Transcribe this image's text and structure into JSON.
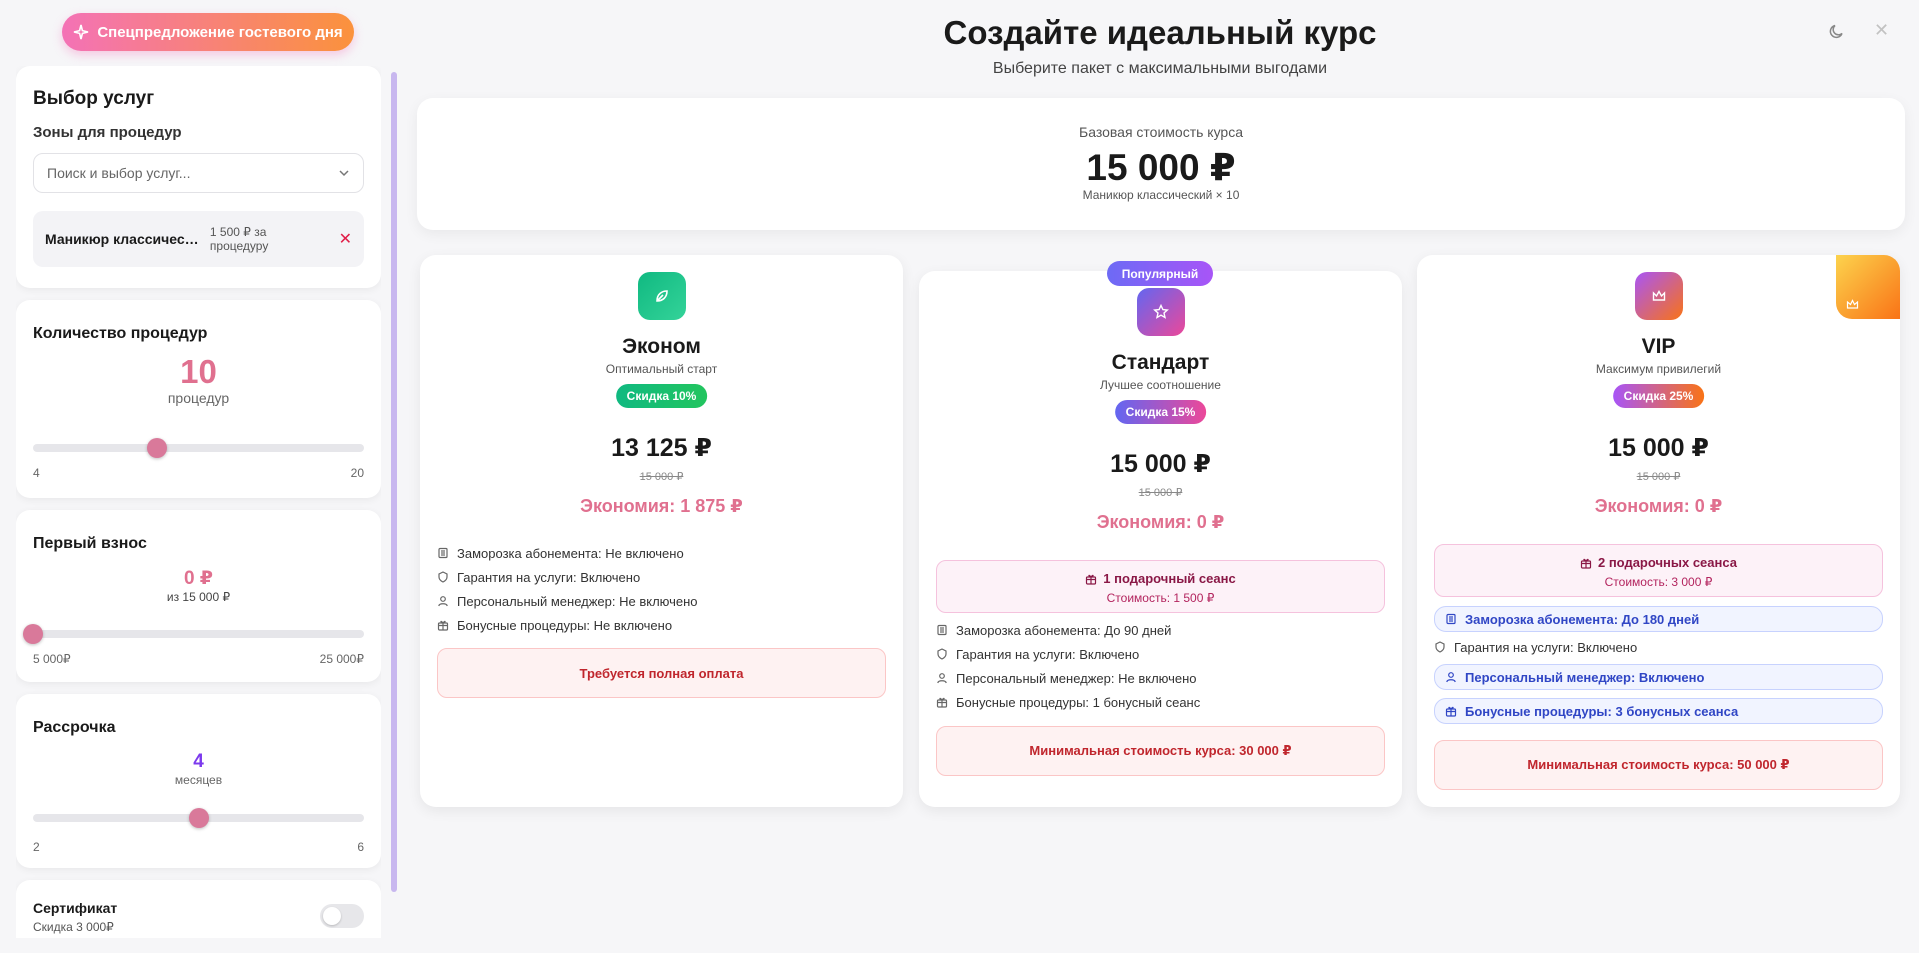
{
  "promo": {
    "label": "Спецпредложение гостевого дня",
    "icon": "sparkles-icon"
  },
  "header": {
    "title": "Создайте идеальный курс",
    "subtitle": "Выберите пакет с максимальными выгодами"
  },
  "top_icons": {
    "theme": "moon-icon",
    "close": "close-icon",
    "close_glyph": "✕"
  },
  "sidebar": {
    "services": {
      "title": "Выбор услуг",
      "zones_label": "Зоны для процедур",
      "search_placeholder": "Поиск и выбор услуг...",
      "selected": {
        "name": "Маникюр классический",
        "price": "1 500 ₽ за процедуру",
        "remove": "✕"
      }
    },
    "count": {
      "title": "Количество процедур",
      "value": "10",
      "unit": "процедур",
      "min": "4",
      "max": "20",
      "level": 0.375
    },
    "deposit": {
      "title": "Первый взнос",
      "value": "0 ₽",
      "of": "из 15 000 ₽",
      "min": "5 000₽",
      "max": "25 000₽",
      "level": 0
    },
    "installment": {
      "title": "Рассрочка",
      "value": "4",
      "unit": "месяцев",
      "min": "2",
      "max": "6",
      "level": 0.5
    },
    "certificate": {
      "title": "Сертификат",
      "sub": "Скидка 3 000₽",
      "enabled": false
    }
  },
  "base": {
    "label": "Базовая стоимость курса",
    "value": "15 000 ₽",
    "sub": "Маникюр классический × 10"
  },
  "popular_label": "Популярный",
  "plans": [
    {
      "name": "Эконом",
      "tagline": "Оптимальный старт",
      "discount": "Скидка 10%",
      "icon": "leaf-icon",
      "price": "13 125 ₽",
      "old_price": "15 000 ₽",
      "saving": "Экономия: 1 875 ₽",
      "features": [
        {
          "icon": "freeze-icon",
          "text": "Заморозка абонемента: Не включено"
        },
        {
          "icon": "shield-icon",
          "text": "Гарантия на услуги: Включено"
        },
        {
          "icon": "user-icon",
          "text": "Персональный менеджер: Не включено"
        },
        {
          "icon": "gift-icon",
          "text": "Бонусные процедуры: Не включено"
        }
      ],
      "warning": "Требуется полная оплата"
    },
    {
      "name": "Стандарт",
      "tagline": "Лучшее соотношение",
      "discount": "Скидка 15%",
      "icon": "star-icon",
      "price": "15 000 ₽",
      "old_price": "15 000 ₽",
      "saving": "Экономия: 0 ₽",
      "gift": {
        "title": "1 подарочный сеанс",
        "cost": "Стоимость: 1 500 ₽"
      },
      "features": [
        {
          "icon": "freeze-icon",
          "text": "Заморозка абонемента: До 90 дней"
        },
        {
          "icon": "shield-icon",
          "text": "Гарантия на услуги: Включено"
        },
        {
          "icon": "user-icon",
          "text": "Персональный менеджер: Не включено"
        },
        {
          "icon": "gift-icon",
          "text": "Бонусные процедуры: 1 бонусный сеанс"
        }
      ],
      "warning": "Минимальная стоимость курса: 30 000 ₽"
    },
    {
      "name": "VIP",
      "tagline": "Максимум привилегий",
      "discount": "Скидка 25%",
      "icon": "crown-icon",
      "price": "15 000 ₽",
      "old_price": "15 000 ₽",
      "saving": "Экономия: 0 ₽",
      "gift": {
        "title": "2 подарочных сеанса",
        "cost": "Стоимость: 3 000 ₽"
      },
      "features": [
        {
          "icon": "freeze-icon",
          "text": "Заморозка абонемента: До 180 дней"
        },
        {
          "icon": "shield-icon",
          "text": "Гарантия на услуги: Включено"
        },
        {
          "icon": "user-icon",
          "text": "Персональный менеджер: Включено"
        },
        {
          "icon": "gift-icon",
          "text": "Бонусные процедуры: 3 бонусных сеанса"
        }
      ],
      "warning": "Минимальная стоимость курса: 50 000 ₽"
    }
  ]
}
